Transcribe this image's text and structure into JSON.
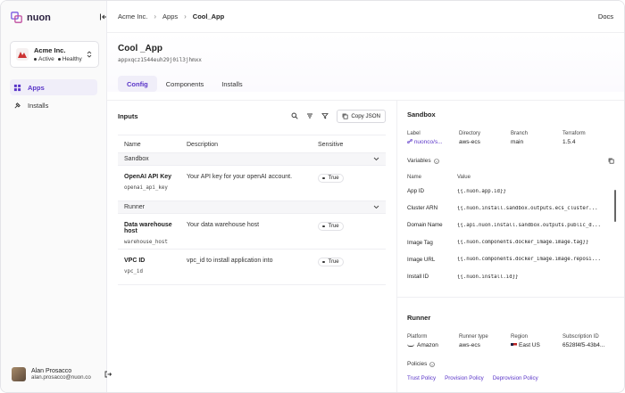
{
  "brand": {
    "name": "nuon"
  },
  "org": {
    "name": "Acme Inc.",
    "status1": "Active",
    "status2": "Healthy"
  },
  "nav": [
    {
      "label": "Apps"
    },
    {
      "label": "Installs"
    }
  ],
  "user": {
    "name": "Alan Prosacco",
    "email": "alan.prosacco@nuon.co"
  },
  "breadcrumb": [
    "Acme Inc.",
    "Apps",
    "Cool_App"
  ],
  "docs": "Docs",
  "app": {
    "title": "Cool _App",
    "id": "appxqcz1544euh29j0il3jhmxx"
  },
  "tabs": [
    "Config",
    "Components",
    "Installs"
  ],
  "inputs": {
    "title": "Inputs",
    "copy_label": "Copy JSON",
    "columns": [
      "Name",
      "Description",
      "Sensitive"
    ],
    "groups": [
      {
        "name": "Sandbox",
        "rows": [
          {
            "name": "OpenAI API Key",
            "key": "openai_api_key",
            "description": "Your API key for your openAI account.",
            "sensitive": "True"
          }
        ]
      },
      {
        "name": "Runner",
        "rows": [
          {
            "name": "Data warehouse host",
            "key": "warehouse_host",
            "description": "Your data warehouse host",
            "sensitive": "True"
          },
          {
            "name": "VPC ID",
            "key": "vpc_id",
            "description": "vpc_id to install application into",
            "sensitive": "True"
          }
        ]
      }
    ]
  },
  "sandbox": {
    "title": "Sandbox",
    "meta": [
      {
        "label": "Label",
        "value": "nuonco/s..."
      },
      {
        "label": "Directory",
        "value": "aws-ecs"
      },
      {
        "label": "Branch",
        "value": "main"
      },
      {
        "label": "Terraform",
        "value": "1.5.4"
      }
    ],
    "variables_label": "Variables",
    "var_columns": [
      "Name",
      "Value"
    ],
    "variables": [
      {
        "name": "App ID",
        "value": "{{.nuon.app.id}}"
      },
      {
        "name": "Cluster ARN",
        "value": "{{.nuon.install.sandbox.outputs.ecs_cluster..."
      },
      {
        "name": "Domain Name",
        "value": "{{.api.nuon.install.sandbox.outputs.public_d..."
      },
      {
        "name": "Image Tag",
        "value": "{{.nuon.components.docker_image.image.tag}}"
      },
      {
        "name": "Image URL",
        "value": "{{.nuon.components.docker_image.image.reposi..."
      },
      {
        "name": "Install ID",
        "value": "{{.nuon.install.id}}"
      }
    ]
  },
  "runner": {
    "title": "Runner",
    "meta": [
      {
        "label": "Platform",
        "value": "Amazon"
      },
      {
        "label": "Runner type",
        "value": "aws-ecs"
      },
      {
        "label": "Region",
        "value": "East US"
      },
      {
        "label": "Subscription ID",
        "value": "6528f4f5-43b4..."
      }
    ],
    "policies_label": "Policies",
    "policies": [
      "Trust Policy",
      "Provision Policy",
      "Deprovision Policy"
    ]
  },
  "colors": {
    "accent": "#5a35c8",
    "accent_bg": "#f0eef9"
  },
  "icons": [
    "nuon-logo-icon",
    "sidebar-collapse-icon",
    "chevron-updown-icon",
    "apps-icon",
    "installs-icon",
    "search-icon",
    "filter-icon",
    "funnel-icon",
    "copy-icon",
    "chevron-down-icon",
    "info-icon",
    "link-icon",
    "logout-icon"
  ]
}
